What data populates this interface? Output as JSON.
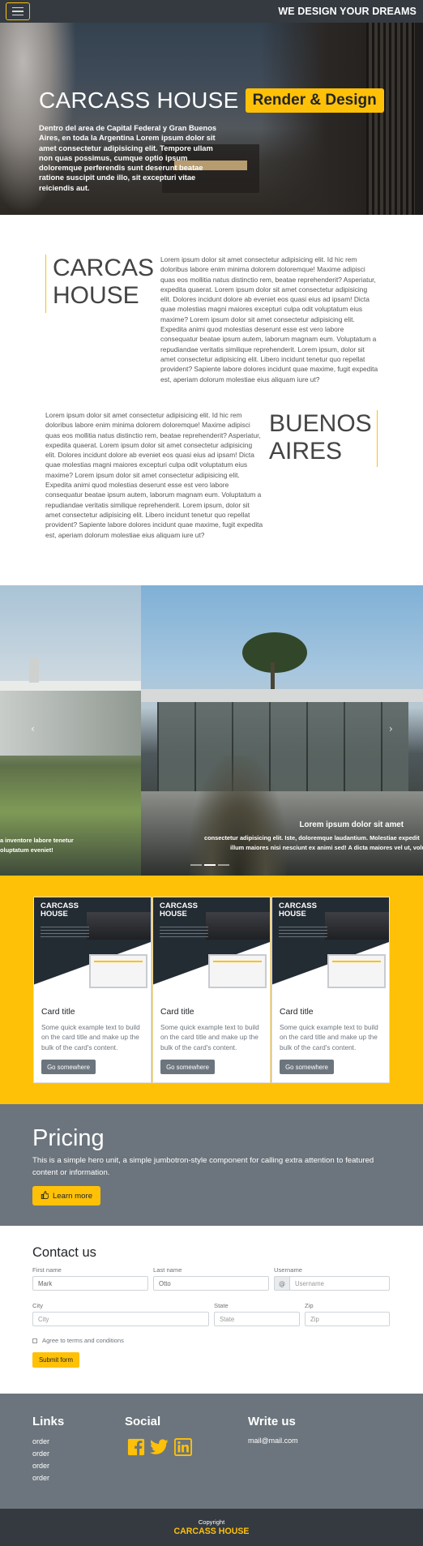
{
  "navbar": {
    "brand": "WE DESIGN YOUR DREAMS",
    "menu_icon": "hamburger-icon"
  },
  "hero": {
    "title": "CARCASS HOUSE",
    "badge": "Render & Design",
    "text": "Dentro del area de Capital Federal y Gran Buenos Aires, en toda la Argentina Lorem ipsum dolor sit amet consectetur adipisicing elit. Tempore ullam non quas possimus, cumque optio ipsum doloremque perferendis sunt deserunt beatae ratione suscipit unde illo, sit excepturi vitae reiciendis aut."
  },
  "section1": {
    "title_line1": "CARCAS",
    "title_line2": "HOUSE",
    "text": "Lorem ipsum dolor sit amet consectetur adipisicing elit. Id hic rem doloribus labore enim minima dolorem doloremque! Maxime adipisci quas eos mollitia natus distinctio rem, beatae reprehenderit? Asperiatur, expedita quaerat. Lorem ipsum dolor sit amet consectetur adipisicing elit. Dolores incidunt dolore ab eveniet eos quasi eius ad ipsam! Dicta quae molestias magni maiores excepturi culpa odit voluptatum eius maxime? Lorem ipsum dolor sit amet consectetur adipisicing elit. Expedita animi quod molestias deserunt esse est vero labore consequatur beatae ipsum autem, laborum magnam eum. Voluptatum a repudiandae veritatis similique reprehenderit. Lorem ipsum, dolor sit amet consectetur adipisicing elit. Libero incidunt tenetur quo repellat provident? Sapiente labore dolores incidunt quae maxime, fugit expedita est, aperiam dolorum molestiae eius aliquam iure ut?"
  },
  "section2": {
    "title_line1": "BUENOS",
    "title_line2": "AIRES",
    "text": "Lorem ipsum dolor sit amet consectetur adipisicing elit. Id hic rem doloribus labore enim minima dolorem doloremque! Maxime adipisci quas eos mollitia natus distinctio rem, beatae reprehenderit? Asperiatur, expedita quaerat. Lorem ipsum dolor sit amet consectetur adipisicing elit. Dolores incidunt dolore ab eveniet eos quasi eius ad ipsam! Dicta quae molestias magni maiores excepturi culpa odit voluptatum eius maxime? Lorem ipsum dolor sit amet consectetur adipisicing elit. Expedita animi quod molestias deserunt esse est vero labore consequatur beatae ipsum autem, laborum magnam eum. Voluptatum a repudiandae veritatis similique reprehenderit. Lorem ipsum, dolor sit amet consectetur adipisicing elit. Libero incidunt tenetur quo repellat provident? Sapiente labore dolores incidunt quae maxime, fugit expedita est, aperiam dolorum molestiae eius aliquam iure ut?"
  },
  "carousel": {
    "left_caption_line1": "a inventore labore tenetur",
    "left_caption_line2": "oluptatum eveniet!",
    "heading": "Lorem ipsum dolor sit amet",
    "line1": "consectetur adipisicing elit. Iste, doloremque laudantium. Molestiae expedit",
    "line2": "illum maiores nisi nesciunt ex animi sed! A dicta maiores vel ut, volu",
    "prev_icon": "chevron-left-icon",
    "next_icon": "chevron-right-icon",
    "active_slide": 2
  },
  "cards": [
    {
      "image_title_l1": "CARCASS",
      "image_title_l2": "HOUSE",
      "title": "Card title",
      "text": "Some quick example text to build on the card title and make up the bulk of the card's content.",
      "button": "Go somewhere"
    },
    {
      "image_title_l1": "CARCASS",
      "image_title_l2": "HOUSE",
      "title": "Card title",
      "text": "Some quick example text to build on the card title and make up the bulk of the card's content.",
      "button": "Go somewhere"
    },
    {
      "image_title_l1": "CARCASS",
      "image_title_l2": "HOUSE",
      "title": "Card title",
      "text": "Some quick example text to build on the card title and make up the bulk of the card's content.",
      "button": "Go somewhere"
    }
  ],
  "pricing": {
    "title": "Pricing",
    "text": "This is a simple hero unit, a simple jumbotron-style component for calling extra attention to featured content or information.",
    "button": "Learn more",
    "button_icon": "thumbs-up-icon"
  },
  "contact": {
    "title": "Contact us",
    "first_name_label": "First name",
    "first_name_value": "Mark",
    "last_name_label": "Last name",
    "last_name_value": "Otto",
    "username_label": "Username",
    "username_placeholder": "Username",
    "username_prefix": "@",
    "city_label": "City",
    "city_placeholder": "City",
    "state_label": "State",
    "state_placeholder": "State",
    "zip_label": "Zip",
    "zip_placeholder": "Zip",
    "agree_label": "Agree to terms and conditions",
    "submit": "Submit form"
  },
  "footer": {
    "links_title": "Links",
    "links": [
      "order",
      "order",
      "order",
      "order"
    ],
    "social_title": "Social",
    "social_icons": [
      "facebook-icon",
      "twitter-icon",
      "linkedin-icon"
    ],
    "write_title": "Write us",
    "email": "mail@mail.com",
    "copyright": "Copyright",
    "brand": "CARCASS HOUSE"
  },
  "colors": {
    "accent": "#ffc107",
    "dark": "#343a40",
    "gray": "#6c757d"
  }
}
